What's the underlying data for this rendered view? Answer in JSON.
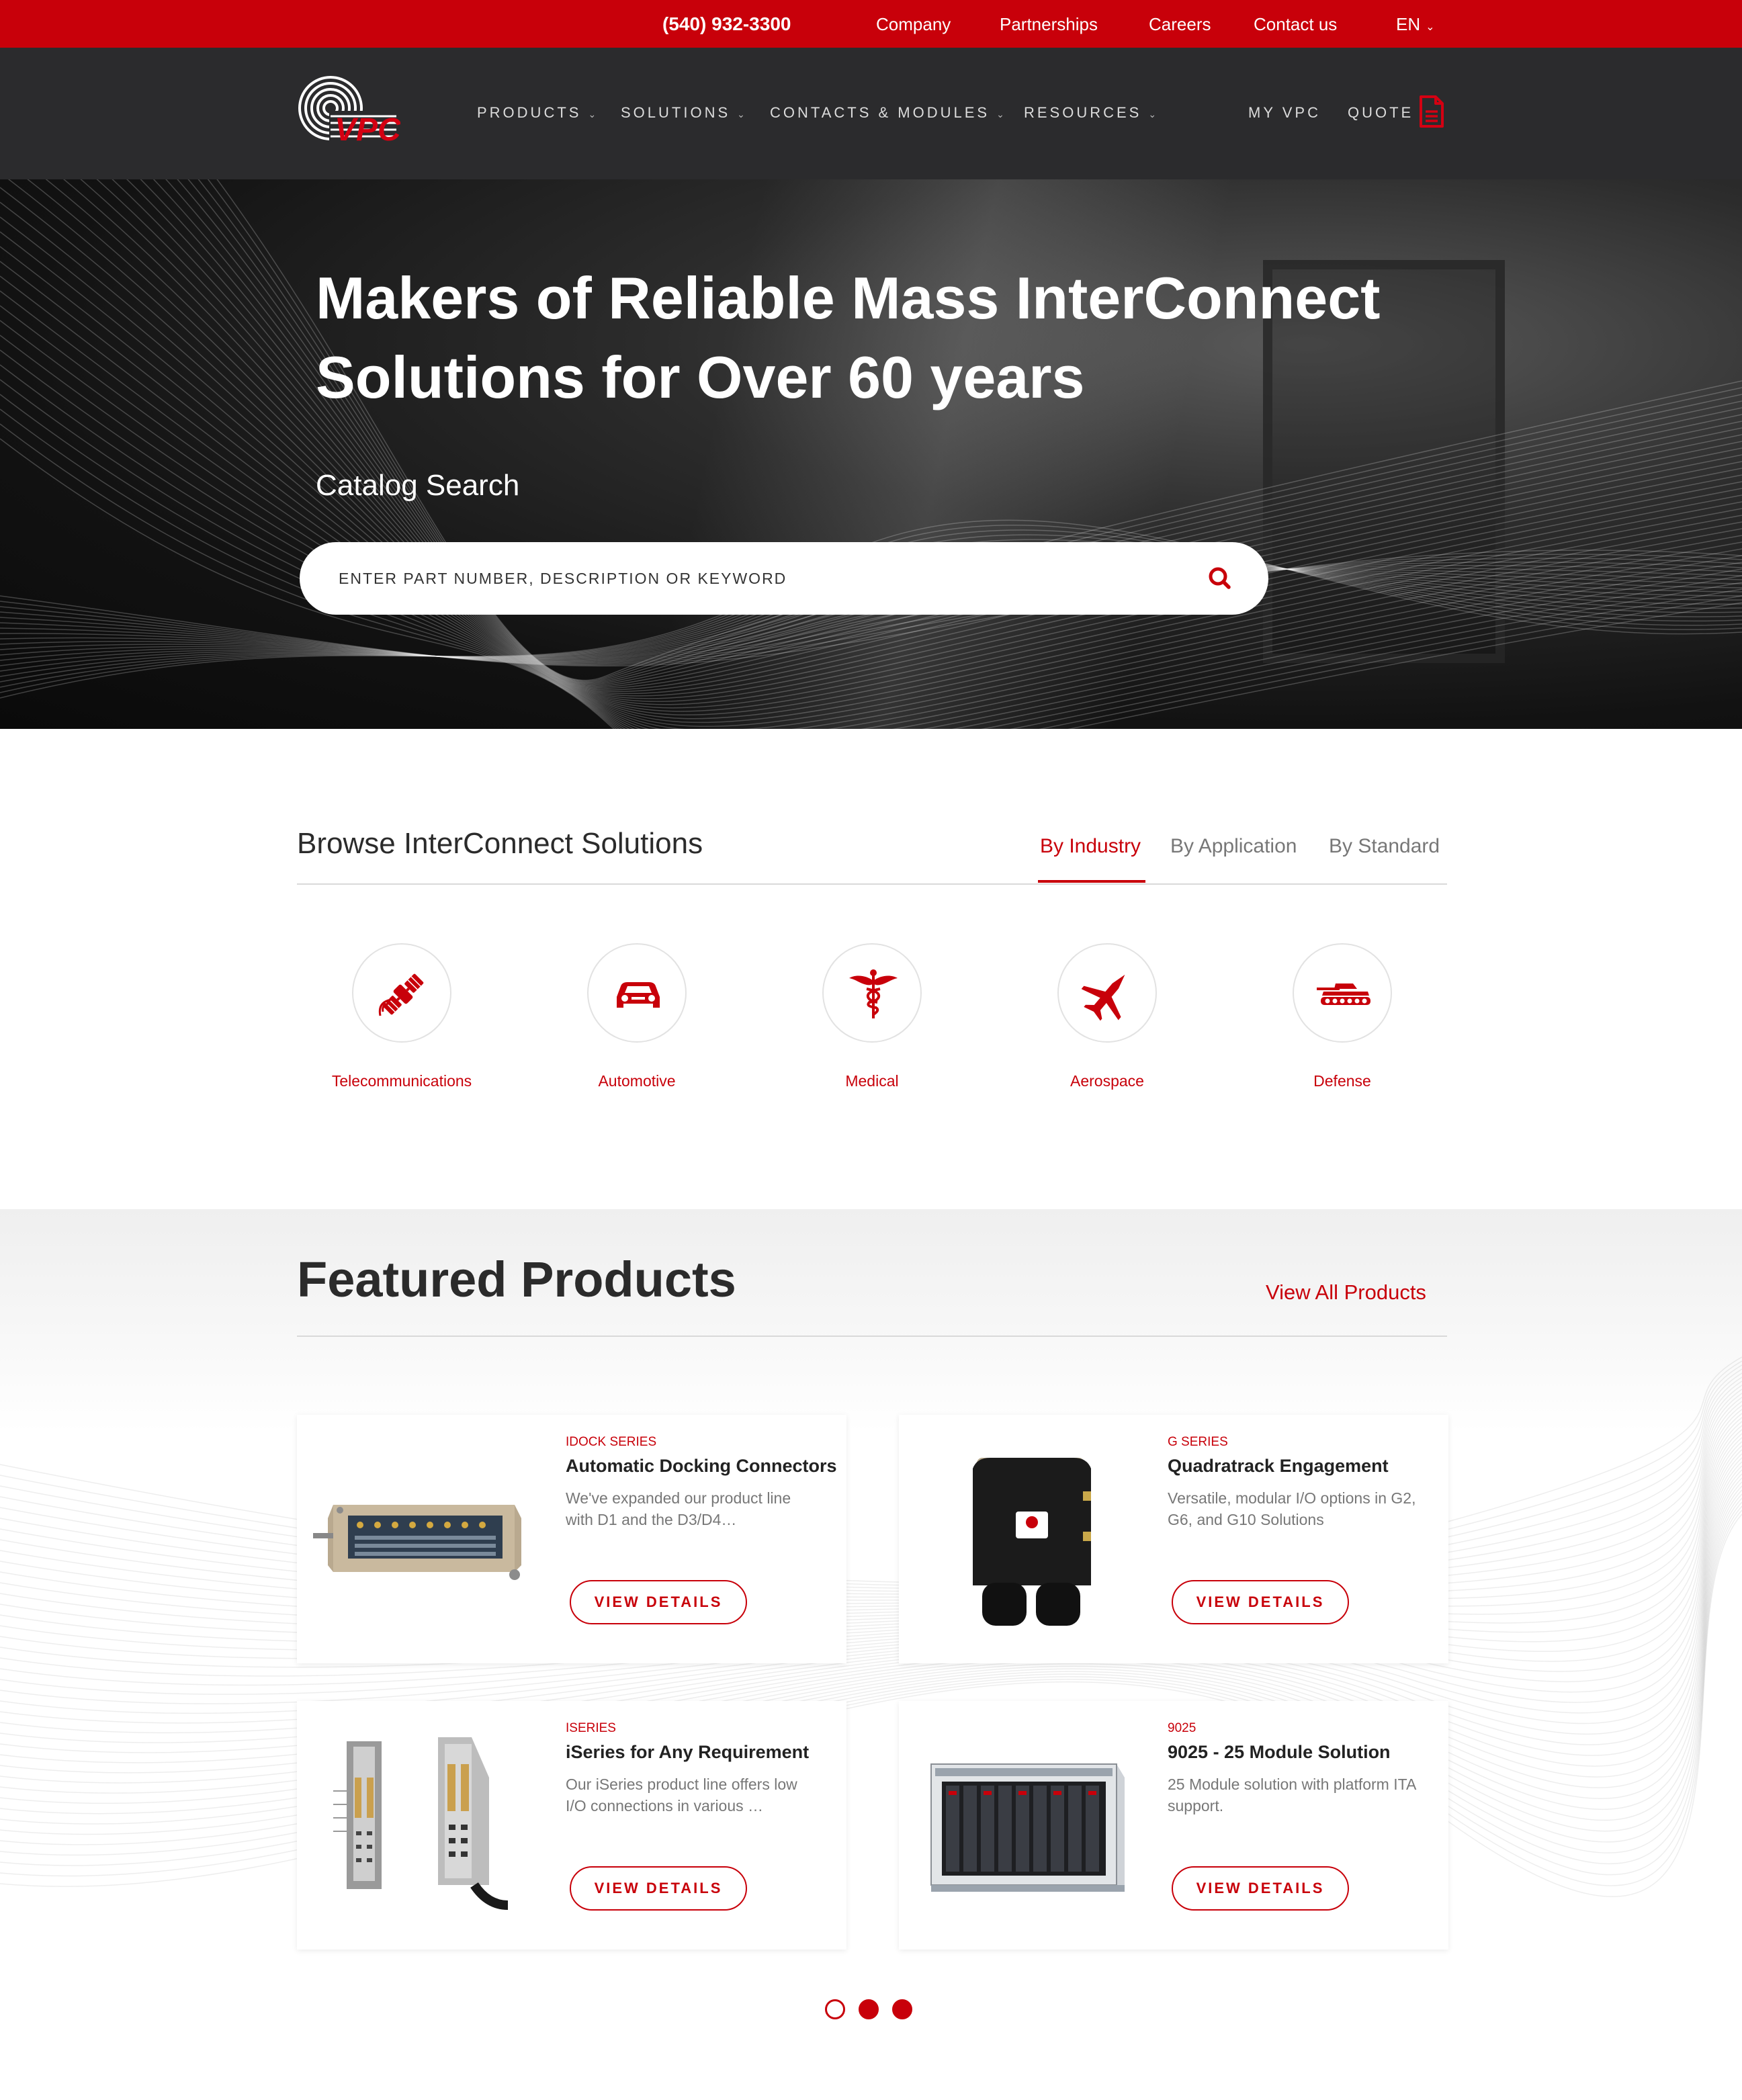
{
  "utility_bar": {
    "phone": "(540) 932-3300",
    "links": [
      "Company",
      "Partnerships",
      "Careers",
      "Contact us"
    ],
    "language": "EN"
  },
  "nav": {
    "logo_text": "VPC",
    "items": [
      "PRODUCTS",
      "SOLUTIONS",
      "CONTACTS & MODULES",
      "RESOURCES"
    ],
    "my_vpc": "MY VPC",
    "quote": "QUOTE"
  },
  "hero": {
    "headline_line1": "Makers of Reliable Mass InterConnect",
    "headline_line2": "Solutions for Over 60 years",
    "catalog_label": "Catalog Search",
    "search_placeholder": "ENTER PART NUMBER, DESCRIPTION OR KEYWORD"
  },
  "browse": {
    "title": "Browse InterConnect Solutions",
    "tabs": [
      "By Industry",
      "By Application",
      "By Standard"
    ],
    "active_tab": "By Industry",
    "industries": [
      {
        "label": "Telecommunications",
        "icon": "satellite-icon"
      },
      {
        "label": "Automotive",
        "icon": "car-icon"
      },
      {
        "label": "Medical",
        "icon": "caduceus-icon"
      },
      {
        "label": "Aerospace",
        "icon": "jet-icon"
      },
      {
        "label": "Defense",
        "icon": "tank-icon"
      }
    ]
  },
  "featured": {
    "title": "Featured Products",
    "view_all": "View  All Products",
    "products": [
      {
        "series": "IDOCK SERIES",
        "title": "Automatic Docking Connectors",
        "desc": "We've expanded our product line with D1 and the D3/D4…",
        "button": "VIEW DETAILS"
      },
      {
        "series": "G SERIES",
        "title": "Quadratrack Engagement",
        "desc": "Versatile, modular I/O options in G2, G6, and G10 Solutions",
        "button": "VIEW DETAILS"
      },
      {
        "series": "ISERIES",
        "title": "iSeries for Any Requirement",
        "desc": "Our iSeries product line offers low I/O connections in various …",
        "button": "VIEW DETAILS"
      },
      {
        "series": "9025",
        "title": "9025 - 25 Module Solution",
        "desc": "25 Module solution with platform ITA support.",
        "button": "VIEW DETAILS"
      }
    ],
    "carousel": {
      "pages": 3,
      "active_page": 1
    }
  },
  "colors": {
    "brand_red": "#c8000a",
    "nav_dark": "#2b2b2d"
  }
}
